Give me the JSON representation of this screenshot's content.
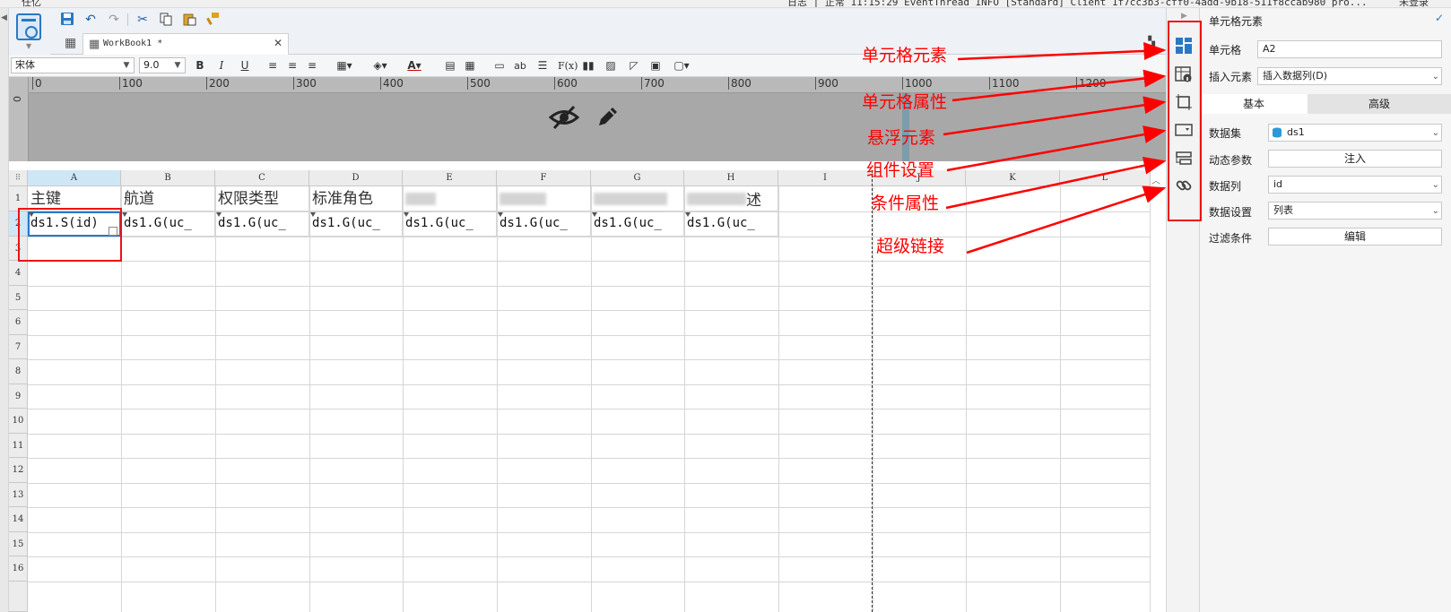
{
  "top_strip": {
    "menu_text": "任亿",
    "log_text": "日志 | 正常 11:15:29 EventThread INFO [Standard] Client 1f7cc3b3-cff0-4add-9b18-511f8ccab980 pro...",
    "login_text": "未登录"
  },
  "tab": {
    "title": "WorkBook1 *",
    "close_symbol": "✕"
  },
  "format_bar": {
    "font_name": "宋体",
    "font_size": "9.0",
    "bold": "B",
    "italic": "I",
    "underline": "U",
    "ab_label": "ab",
    "fx_label": "F(x)"
  },
  "ruler": {
    "ticks": [
      "0",
      "100",
      "200",
      "300",
      "400",
      "500",
      "600",
      "700",
      "800",
      "900",
      "1000",
      "1100",
      "1200"
    ],
    "vertical_zero": "0"
  },
  "sheet": {
    "columns": [
      "A",
      "B",
      "C",
      "D",
      "E",
      "F",
      "G",
      "H",
      "I",
      "J",
      "K",
      "L"
    ],
    "rows": [
      "1",
      "2",
      "3",
      "4",
      "5",
      "6",
      "7",
      "8",
      "9",
      "10",
      "11",
      "12",
      "13",
      "14",
      "15",
      "16"
    ],
    "row1": [
      "主键",
      "航道",
      "权限类型",
      "标准角色",
      "",
      "",
      "",
      "述"
    ],
    "row2": [
      "ds1.S(id)",
      "ds1.G(uc_",
      "ds1.G(uc_",
      "ds1.G(uc_",
      "ds1.G(uc_",
      "ds1.G(uc_",
      "ds1.G(uc_",
      "ds1.G(uc_"
    ],
    "selected_cell": "A2"
  },
  "side_icons": [
    "cell-element-icon",
    "cell-attribute-icon",
    "float-element-icon",
    "widget-settings-icon",
    "condition-attribute-icon",
    "hyperlink-icon"
  ],
  "panel": {
    "title": "单元格元素",
    "cell_label": "单元格",
    "cell_value": "A2",
    "insert_label": "插入元素",
    "insert_value": "插入数据列(D)",
    "tab_basic": "基本",
    "tab_advanced": "高级",
    "dataset_label": "数据集",
    "dataset_value": "ds1",
    "dynamic_label": "动态参数",
    "dynamic_button": "注入",
    "column_label": "数据列",
    "column_value": "id",
    "setting_label": "数据设置",
    "setting_value": "列表",
    "filter_label": "过滤条件",
    "filter_button": "编辑"
  },
  "annotations": [
    "单元格元素",
    "单元格属性",
    "悬浮元素",
    "组件设置",
    "条件属性",
    "超级链接"
  ],
  "colors": {
    "annotation": "#ff0000",
    "accent": "#2a78c5",
    "selected_header": "#cfe6f7"
  }
}
